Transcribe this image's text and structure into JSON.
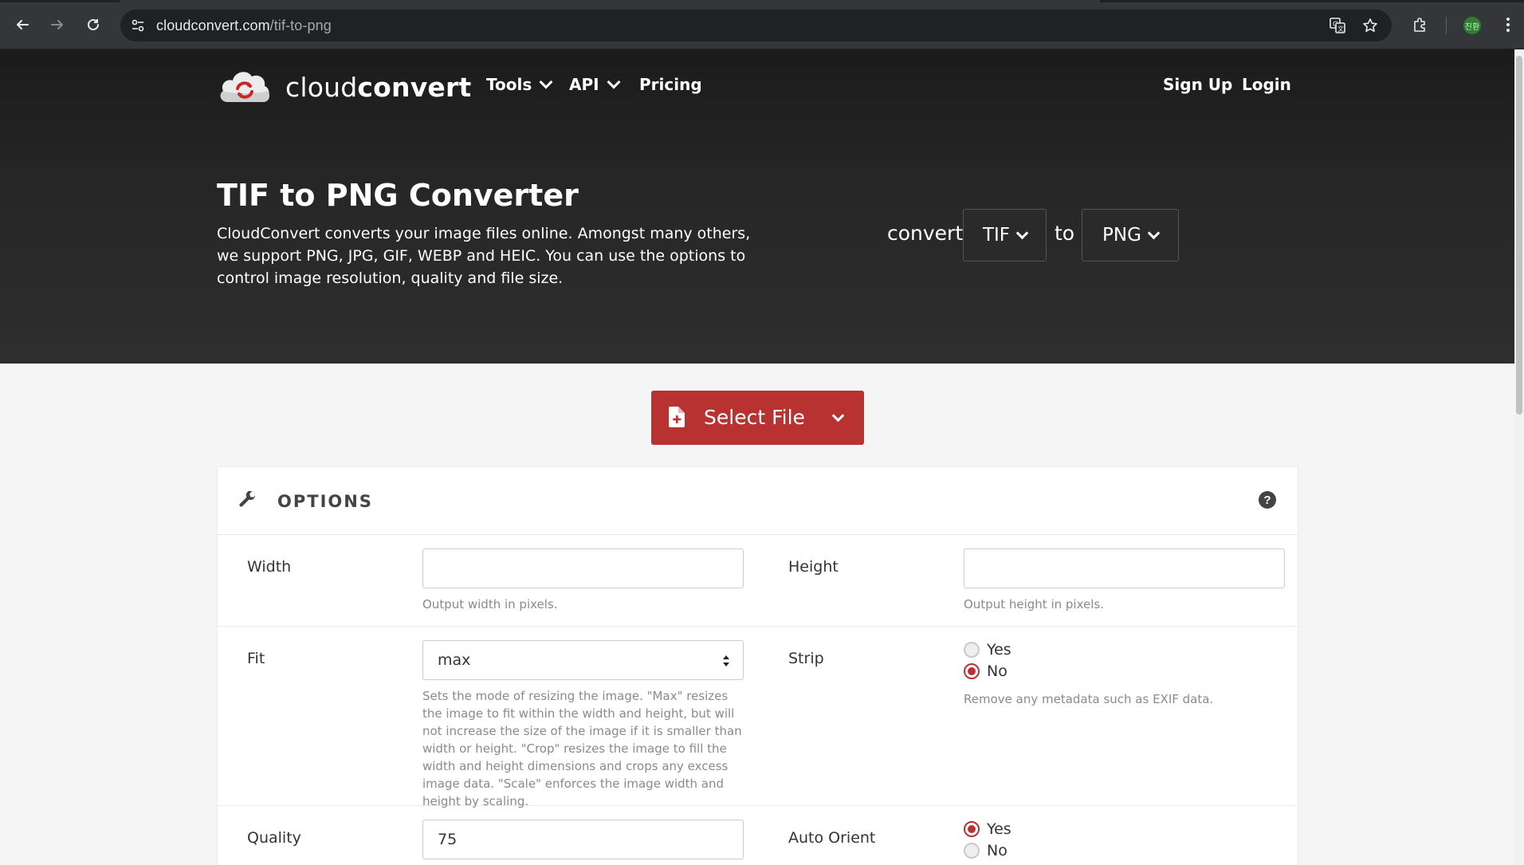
{
  "browser": {
    "url_host": "cloudconvert.com",
    "url_path": "/tif-to-png",
    "profile_initials": "진환"
  },
  "header": {
    "brand_light": "cloud",
    "brand_bold": "convert",
    "nav": {
      "tools": "Tools",
      "api": "API",
      "pricing": "Pricing",
      "signup": "Sign Up",
      "login": "Login"
    }
  },
  "hero": {
    "title": "TIF to PNG Converter",
    "description": "CloudConvert converts your image files online. Amongst many others, we support PNG, JPG, GIF, WEBP and HEIC. You can use the options to control image resolution, quality and file size.",
    "convert_label": "convert",
    "to_label": "to",
    "from_format": "TIF",
    "to_format": "PNG"
  },
  "select_file": {
    "label": "Select File"
  },
  "options": {
    "title": "OPTIONS",
    "help_symbol": "?",
    "width": {
      "label": "Width",
      "value": "",
      "help": "Output width in pixels."
    },
    "height": {
      "label": "Height",
      "value": "",
      "help": "Output height in pixels."
    },
    "fit": {
      "label": "Fit",
      "value": "max",
      "help": "Sets the mode of resizing the image. \"Max\" resizes the image to fit within the width and height, but will not increase the size of the image if it is smaller than width or height. \"Crop\" resizes the image to fill the width and height dimensions and crops any excess image data. \"Scale\" enforces the image width and height by scaling."
    },
    "strip": {
      "label": "Strip",
      "yes": "Yes",
      "no": "No",
      "selected": "No",
      "help": "Remove any metadata such as EXIF data."
    },
    "quality": {
      "label": "Quality",
      "value": "75"
    },
    "auto_orient": {
      "label": "Auto Orient",
      "yes": "Yes",
      "no": "No",
      "selected": "Yes"
    }
  },
  "colors": {
    "accent": "#b83232",
    "hero_bg": "#262626",
    "page_bg": "#f5f5f5"
  }
}
